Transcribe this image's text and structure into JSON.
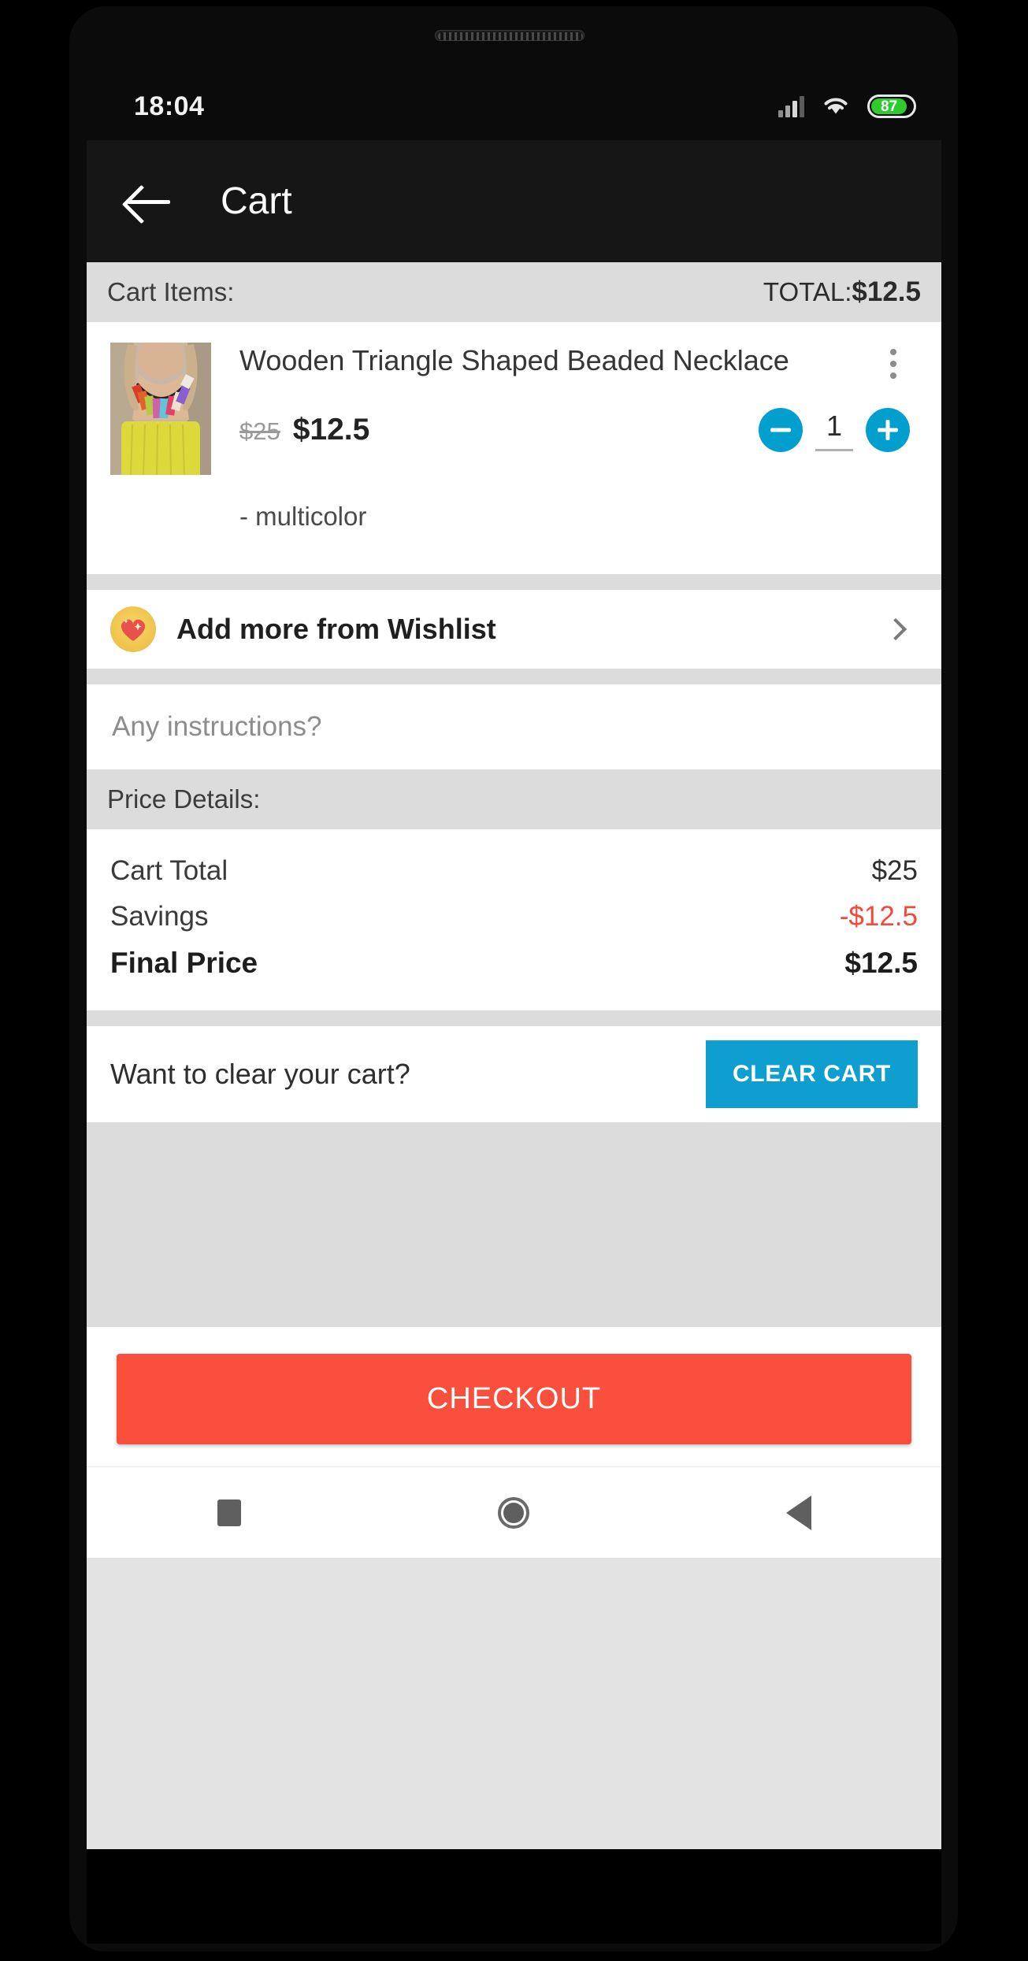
{
  "status_bar": {
    "time": "18:04",
    "signal_icon": "signal-bars-icon",
    "wifi_icon": "wifi-icon",
    "battery_percent": "87",
    "battery_level": 87
  },
  "app_bar": {
    "back_icon": "back-arrow-icon",
    "title": "Cart"
  },
  "cart_header": {
    "label": "Cart Items:",
    "total_prefix": "TOTAL:",
    "total_value": "$12.5"
  },
  "cart_item": {
    "title": "Wooden Triangle Shaped Beaded Necklace",
    "original_price": "$25",
    "sale_price": "$12.5",
    "variant": "- multicolor",
    "quantity": "1",
    "decrement_label": "minus-icon",
    "increment_label": "plus-icon",
    "overflow_icon": "kebab-menu-icon",
    "thumbnail_alt": "woman wearing multicolor wooden beaded necklace with yellow top"
  },
  "wishlist": {
    "icon": "heart-badge-icon",
    "label": "Add more from Wishlist",
    "chevron_icon": "chevron-right-icon"
  },
  "instructions": {
    "placeholder": "Any instructions?",
    "value": ""
  },
  "price_details": {
    "header": "Price Details:",
    "rows": [
      {
        "label": "Cart Total",
        "value": "$25"
      },
      {
        "label": "Savings",
        "value": "-$12.5"
      },
      {
        "label": "Final Price",
        "value": "$12.5"
      }
    ]
  },
  "clear_cart": {
    "prompt": "Want to clear your cart?",
    "button_label": "CLEAR CART"
  },
  "checkout": {
    "button_label": "CHECKOUT"
  },
  "nav_bar": {
    "recents_icon": "recents-square-icon",
    "home_icon": "home-circle-icon",
    "back_icon": "back-triangle-icon"
  },
  "colors": {
    "accent_blue": "#009fce",
    "clear_button_blue": "#0e9fd0",
    "checkout_red": "#fb4f3e",
    "savings_red": "#f4483a",
    "battery_green": "#2ecb2e",
    "app_bar_black": "#161616",
    "strip_gray": "#dcdcdc"
  }
}
